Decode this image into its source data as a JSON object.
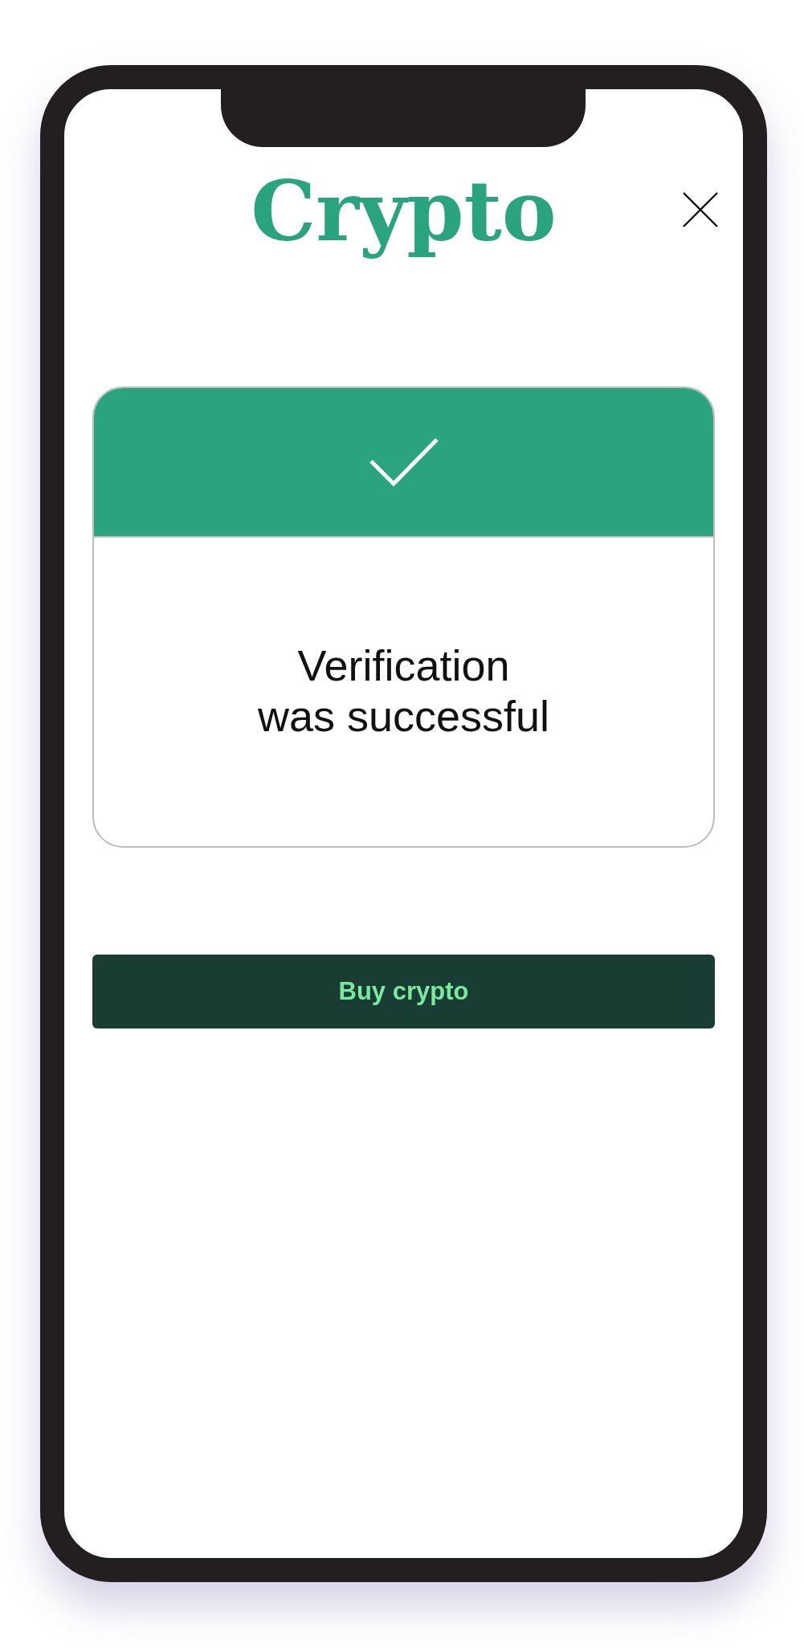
{
  "app": {
    "title": "Crypto"
  },
  "status_card": {
    "message": "Verification\nwas successful"
  },
  "buttons": [
    {
      "label": "Buy crypto"
    }
  ]
}
